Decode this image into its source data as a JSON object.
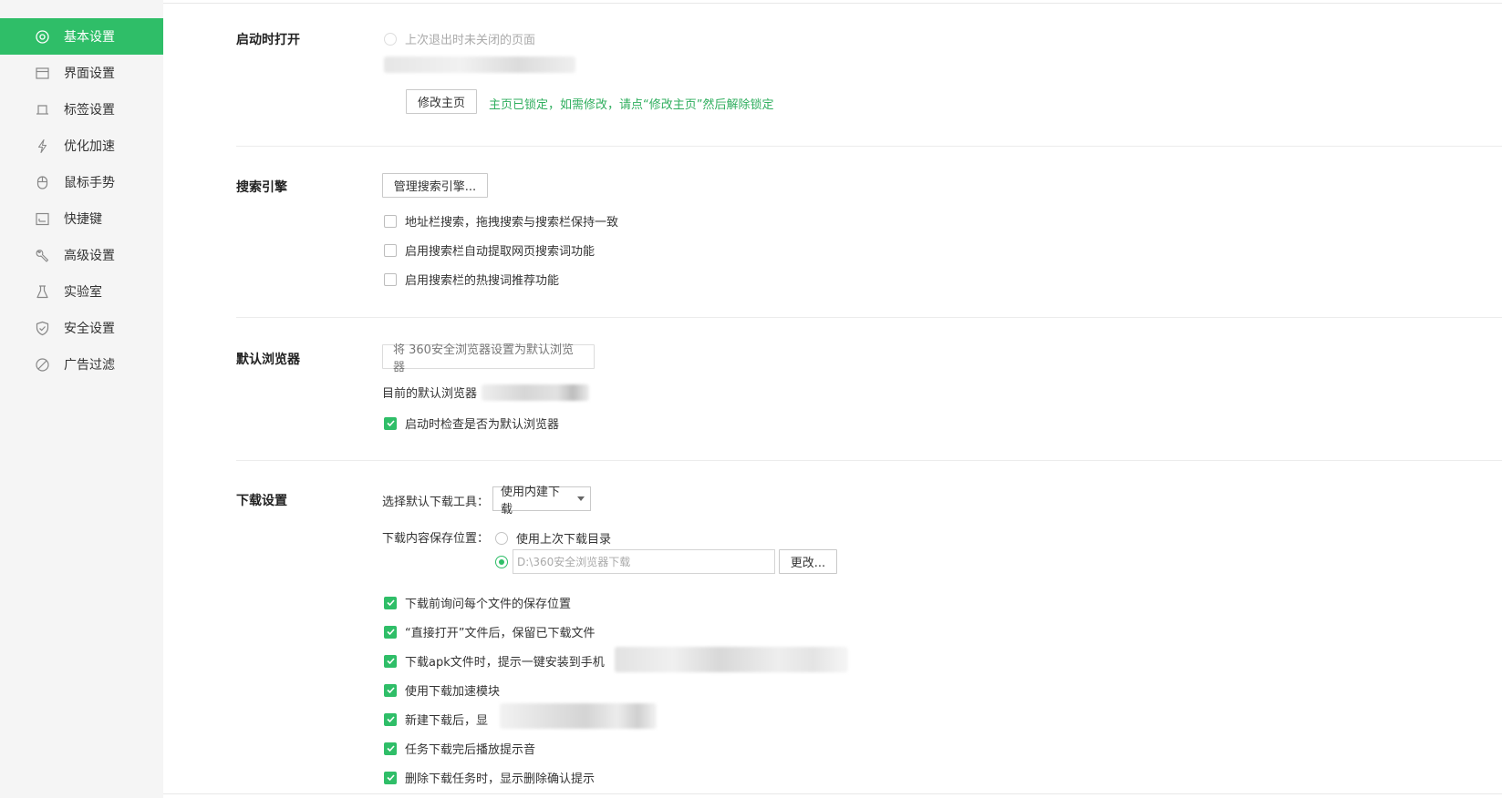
{
  "sidebar": {
    "items": [
      {
        "label": "基本设置",
        "icon": "settings-circle-icon"
      },
      {
        "label": "界面设置",
        "icon": "window-icon"
      },
      {
        "label": "标签设置",
        "icon": "tab-icon"
      },
      {
        "label": "优化加速",
        "icon": "lightning-icon"
      },
      {
        "label": "鼠标手势",
        "icon": "mouse-icon"
      },
      {
        "label": "快捷键",
        "icon": "keyboard-icon"
      },
      {
        "label": "高级设置",
        "icon": "wrench-icon"
      },
      {
        "label": "实验室",
        "icon": "flask-icon"
      },
      {
        "label": "安全设置",
        "icon": "shield-icon"
      },
      {
        "label": "广告过滤",
        "icon": "block-icon"
      }
    ],
    "active_index": 0
  },
  "startup": {
    "title": "启动时打开",
    "last_session_option": "上次退出时未关闭的页面",
    "change_home_button": "修改主页",
    "locked_note": "主页已锁定，如需修改，请点“修改主页”然后解除锁定"
  },
  "search": {
    "title": "搜索引擎",
    "manage_button": "管理搜索引擎...",
    "options": [
      {
        "label": "地址栏搜索，拖拽搜索与搜索栏保持一致",
        "checked": false
      },
      {
        "label": "启用搜索栏自动提取网页搜索词功能",
        "checked": false
      },
      {
        "label": "启用搜索栏的热搜词推荐功能",
        "checked": false
      }
    ]
  },
  "default_browser": {
    "title": "默认浏览器",
    "set_default_button": "将 360安全浏览器设置为默认浏览器",
    "current_label": "目前的默认浏览器",
    "check_on_start": {
      "label": "启动时检查是否为默认浏览器",
      "checked": true
    }
  },
  "download": {
    "title": "下载设置",
    "tool_label": "选择默认下载工具：",
    "tool_value": "使用内建下载",
    "location_label": "下载内容保存位置：",
    "use_last_dir": "使用上次下载目录",
    "path_value": "D:\\360安全浏览器下载",
    "change_button": "更改...",
    "options": [
      {
        "label": "下载前询问每个文件的保存位置",
        "checked": true
      },
      {
        "label": "“直接打开”文件后，保留已下载文件",
        "checked": true
      },
      {
        "label": "下载apk文件时，提示一键安装到手机",
        "checked": true
      },
      {
        "label": "使用下载加速模块",
        "checked": true
      },
      {
        "label": "新建下载后，显",
        "checked": true
      },
      {
        "label": "任务下载完后播放提示音",
        "checked": true
      },
      {
        "label": "删除下载任务时，显示删除确认提示",
        "checked": true
      }
    ]
  },
  "colors": {
    "accent": "#2fbe68",
    "note_green": "#2fae5e"
  }
}
